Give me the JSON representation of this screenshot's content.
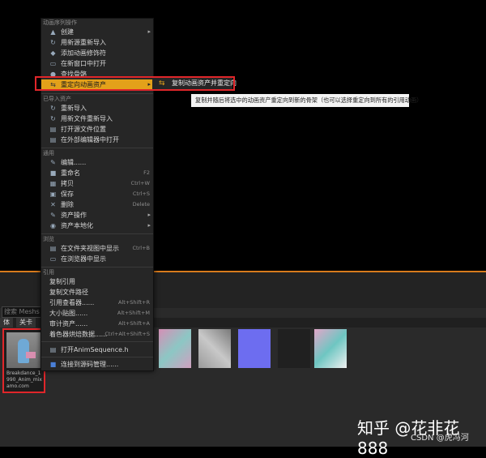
{
  "menu": {
    "sections": [
      {
        "title": "动画序列操作",
        "items": [
          {
            "icon": "▲",
            "label": "创建",
            "shortcut": "",
            "arrow": "▸"
          },
          {
            "icon": "↻",
            "label": "用新源重新导入",
            "shortcut": "",
            "arrow": ""
          },
          {
            "icon": "◆",
            "label": "添加动画修饰符",
            "shortcut": "",
            "arrow": ""
          },
          {
            "icon": "▭",
            "label": "在新窗口中打开",
            "shortcut": "",
            "arrow": ""
          },
          {
            "icon": "●",
            "label": "查找骨骼",
            "shortcut": "",
            "arrow": ""
          },
          {
            "icon": "⇆",
            "label": "重定向动画资产",
            "shortcut": "",
            "arrow": "▸"
          }
        ]
      },
      {
        "title": "已导入资产",
        "items": [
          {
            "icon": "↻",
            "label": "重新导入",
            "shortcut": "",
            "arrow": ""
          },
          {
            "icon": "↻",
            "label": "用新文件重新导入",
            "shortcut": "",
            "arrow": ""
          },
          {
            "icon": "▤",
            "label": "打开源文件位置",
            "shortcut": "",
            "arrow": ""
          },
          {
            "icon": "▤",
            "label": "在外部编辑器中打开",
            "shortcut": "",
            "arrow": ""
          }
        ]
      },
      {
        "title": "通用",
        "items": [
          {
            "icon": "✎",
            "label": "编辑......",
            "shortcut": "",
            "arrow": ""
          },
          {
            "icon": "■",
            "label": "重命名",
            "shortcut": "F2",
            "arrow": ""
          },
          {
            "icon": "▦",
            "label": "拷贝",
            "shortcut": "Ctrl+W",
            "arrow": ""
          },
          {
            "icon": "▣",
            "label": "保存",
            "shortcut": "Ctrl+S",
            "arrow": ""
          },
          {
            "icon": "✕",
            "label": "删除",
            "shortcut": "Delete",
            "arrow": ""
          },
          {
            "icon": "✎",
            "label": "资产操作",
            "shortcut": "",
            "arrow": "▸"
          },
          {
            "icon": "◉",
            "label": "资产本地化",
            "shortcut": "",
            "arrow": "▸"
          }
        ]
      },
      {
        "title": "浏览",
        "items": [
          {
            "icon": "▤",
            "label": "在文件夹视图中显示",
            "shortcut": "Ctrl+B",
            "arrow": ""
          },
          {
            "icon": "▭",
            "label": "在浏览器中显示",
            "shortcut": "",
            "arrow": ""
          }
        ]
      },
      {
        "title": "引用",
        "items": [
          {
            "icon": "",
            "label": "复制引用",
            "shortcut": "",
            "arrow": ""
          },
          {
            "icon": "",
            "label": "复制文件路径",
            "shortcut": "",
            "arrow": ""
          },
          {
            "icon": "",
            "label": "引用查看器......",
            "shortcut": "Alt+Shift+R",
            "arrow": ""
          },
          {
            "icon": "",
            "label": "大小贴图......",
            "shortcut": "Alt+Shift+M",
            "arrow": ""
          },
          {
            "icon": "",
            "label": "审计资产......",
            "shortcut": "Alt+Shift+A",
            "arrow": ""
          },
          {
            "icon": "",
            "label": "着色器烘焙数据......",
            "shortcut": "Ctrl+Alt+Shift+S",
            "arrow": ""
          },
          {
            "icon": "▤",
            "label": "打开AnimSequence.h",
            "shortcut": "",
            "arrow": ""
          },
          {
            "icon": "■",
            "label": "连接到源码管理......",
            "shortcut": "",
            "arrow": ""
          }
        ]
      }
    ]
  },
  "submenu": {
    "icon": "⇆",
    "label": "复制动画资产并重定向"
  },
  "tooltip": "复制并随后将选中的动画资产重定向到新的骨架（也可以选择重定向到所有的引用动画）",
  "search": {
    "placeholder": "搜索 Meshs"
  },
  "filters": [
    "体",
    "关卡"
  ],
  "asset": {
    "label": "Breakdance_1990_Anim_mixamo.com"
  },
  "watermark": {
    "main": "知乎 @花非花888",
    "sub": "CSDN @虎冯河"
  },
  "colors": {
    "highlight": "#e3a11a",
    "outline": "#e0262a",
    "accent": "#d77a1c"
  }
}
